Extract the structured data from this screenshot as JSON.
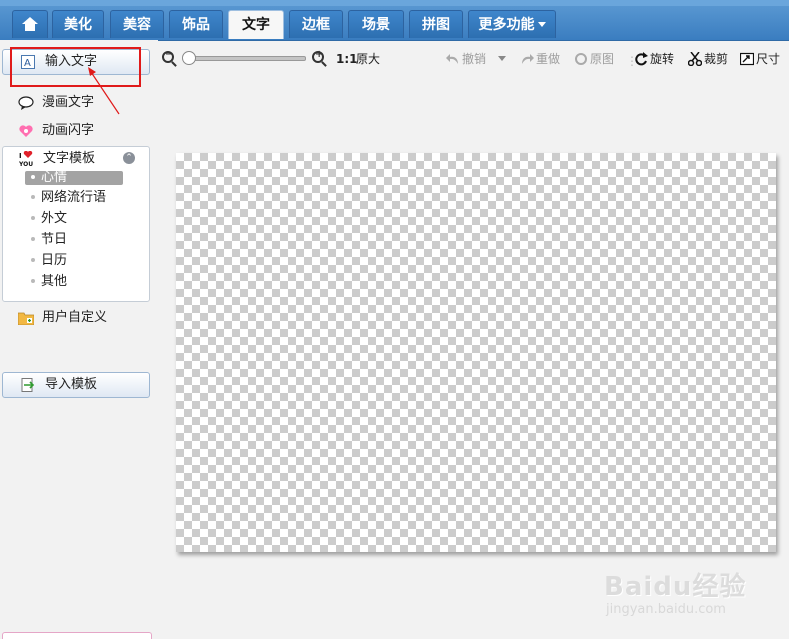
{
  "menu": {
    "tabs": [
      {
        "label": "",
        "icon": "home-icon"
      },
      {
        "label": "美化"
      },
      {
        "label": "美容"
      },
      {
        "label": "饰品"
      },
      {
        "label": "文字",
        "active": true
      },
      {
        "label": "边框"
      },
      {
        "label": "场景"
      },
      {
        "label": "拼图"
      },
      {
        "label": "更多功能"
      }
    ]
  },
  "sidebar": {
    "input_text_label": "输入文字",
    "comic_text_label": "漫画文字",
    "animated_text_label": "动画闪字",
    "template_header": "文字模板",
    "template_items": [
      "心情",
      "网络流行语",
      "外文",
      "节日",
      "日历",
      "其他"
    ],
    "selected_template": "心情",
    "user_defined_label": "用户自定义",
    "import_template_label": "导入模板"
  },
  "toolbar": {
    "ratio_label": "1:1",
    "original_size_label": "原大",
    "undo_label": "撤销",
    "redo_label": "重做",
    "original_image_label": "原图",
    "rotate_label": "旋转",
    "crop_label": "裁剪",
    "size_label": "尺寸"
  },
  "watermark": {
    "main": "Baidu经验",
    "sub": "jingyan.baidu.com"
  },
  "colors": {
    "tab_blue": "#3a7dc0",
    "highlight_red": "#e01a1a",
    "selected_gray": "#a3a3a3"
  }
}
